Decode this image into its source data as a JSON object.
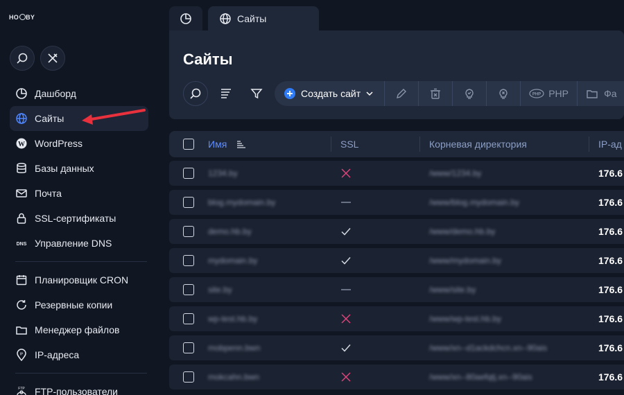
{
  "logo": {
    "text_left": "HO",
    "text_right": "BY"
  },
  "sidebar": {
    "items": [
      {
        "label": "Дашборд",
        "icon": "pie-chart-icon"
      },
      {
        "label": "Сайты",
        "icon": "globe-icon",
        "active": true
      },
      {
        "label": "WordPress",
        "icon": "wordpress-icon"
      },
      {
        "label": "Базы данных",
        "icon": "database-icon"
      },
      {
        "label": "Почта",
        "icon": "mail-icon"
      },
      {
        "label": "SSL-сертификаты",
        "icon": "lock-icon"
      },
      {
        "label": "Управление DNS",
        "icon": "dns-icon"
      },
      {
        "label": "Планировщик CRON",
        "icon": "calendar-icon"
      },
      {
        "label": "Резервные копии",
        "icon": "refresh-icon"
      },
      {
        "label": "Менеджер файлов",
        "icon": "folder-icon"
      },
      {
        "label": "IP-адреса",
        "icon": "ip-pin-icon"
      },
      {
        "label": "FTP-пользователи",
        "icon": "ftp-icon"
      }
    ]
  },
  "tabs": {
    "sites_label": "Сайты"
  },
  "main": {
    "title": "Сайты",
    "toolbar": {
      "create_label": "Создать сайт",
      "php_label": "PHP",
      "files_label": "Фа"
    }
  },
  "table": {
    "columns": {
      "name": "Имя",
      "ssl": "SSL",
      "root": "Корневая директория",
      "ip": "IP-ад"
    },
    "rows": [
      {
        "name": "1234.by",
        "ssl": "none",
        "root": "/www/1234.by",
        "ip": "176.6"
      },
      {
        "name": "blog.mydomain.by",
        "ssl": "dash",
        "root": "/www/blog.mydomain.by",
        "ip": "176.6"
      },
      {
        "name": "demo.hb.by",
        "ssl": "check",
        "root": "/www/demo.hb.by",
        "ip": "176.6"
      },
      {
        "name": "mydomain.by",
        "ssl": "check",
        "root": "/www/mydomain.by",
        "ip": "176.6"
      },
      {
        "name": "site.by",
        "ssl": "dash",
        "root": "/www/site.by",
        "ip": "176.6"
      },
      {
        "name": "wp-test.hb.by",
        "ssl": "none",
        "root": "/www/wp-test.hb.by",
        "ip": "176.6"
      },
      {
        "name": "mobpenn.bwn",
        "ssl": "check",
        "root": "/www/xn--d1ackdchcn.xn--90ais",
        "ip": "176.6"
      },
      {
        "name": "mokcahn.bwn",
        "ssl": "none",
        "root": "/www/xn--80aefqtj.xn--90ais",
        "ip": "176.6"
      }
    ]
  },
  "colors": {
    "accent": "#2f7cf6",
    "ssl_none": "#e0457b",
    "arrow": "#e8313d"
  }
}
